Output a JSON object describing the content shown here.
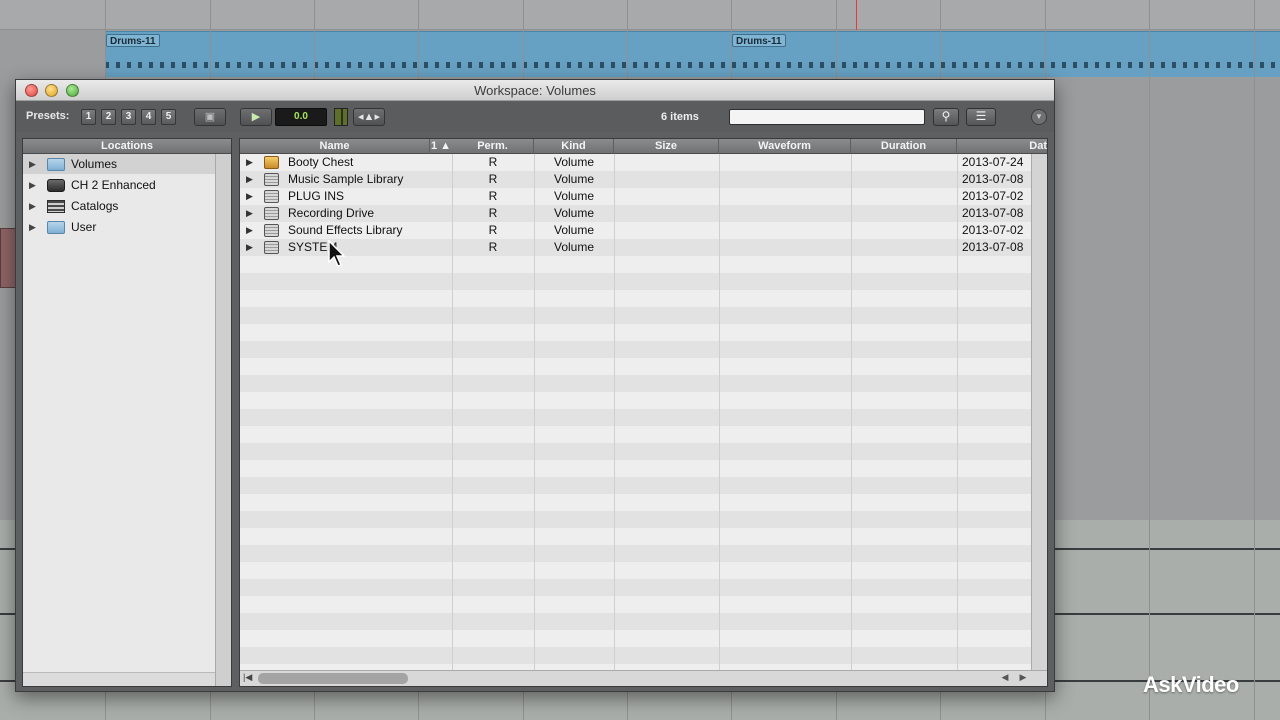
{
  "background": {
    "clips": [
      "Drums-11",
      "Drums-11"
    ]
  },
  "window": {
    "title": "Workspace: Volumes",
    "toolbar": {
      "presets_label": "Presets:",
      "presets": [
        "1",
        "2",
        "3",
        "4",
        "5"
      ],
      "counter_value": "0.0",
      "items_count": "6 items",
      "search_placeholder": ""
    },
    "locations": {
      "header": "Locations",
      "items": [
        {
          "label": "Volumes",
          "icon": "folder-icon",
          "selected": true
        },
        {
          "label": "CH 2 Enhanced",
          "icon": "hard-drive-icon",
          "selected": false
        },
        {
          "label": "Catalogs",
          "icon": "catalog-icon",
          "selected": false
        },
        {
          "label": "User",
          "icon": "folder-icon",
          "selected": false
        }
      ]
    },
    "list": {
      "columns": [
        "Name",
        "1",
        "Perm.",
        "Kind",
        "Size",
        "Waveform",
        "Duration",
        "Dat"
      ],
      "rows": [
        {
          "name": "Booty Chest",
          "perm": "R",
          "kind": "Volume",
          "date": "2013-07-24",
          "icon": "booty-volume-icon"
        },
        {
          "name": "Music Sample Library",
          "perm": "R",
          "kind": "Volume",
          "date": "2013-07-08",
          "icon": "drive-icon"
        },
        {
          "name": "PLUG INS",
          "perm": "R",
          "kind": "Volume",
          "date": "2013-07-02",
          "icon": "drive-icon"
        },
        {
          "name": "Recording Drive",
          "perm": "R",
          "kind": "Volume",
          "date": "2013-07-08",
          "icon": "drive-icon"
        },
        {
          "name": "Sound Effects Library",
          "perm": "R",
          "kind": "Volume",
          "date": "2013-07-02",
          "icon": "drive-icon"
        },
        {
          "name": "SYSTEM",
          "perm": "R",
          "kind": "Volume",
          "date": "2013-07-08",
          "icon": "drive-icon"
        }
      ]
    }
  },
  "watermark": "AskVideo"
}
